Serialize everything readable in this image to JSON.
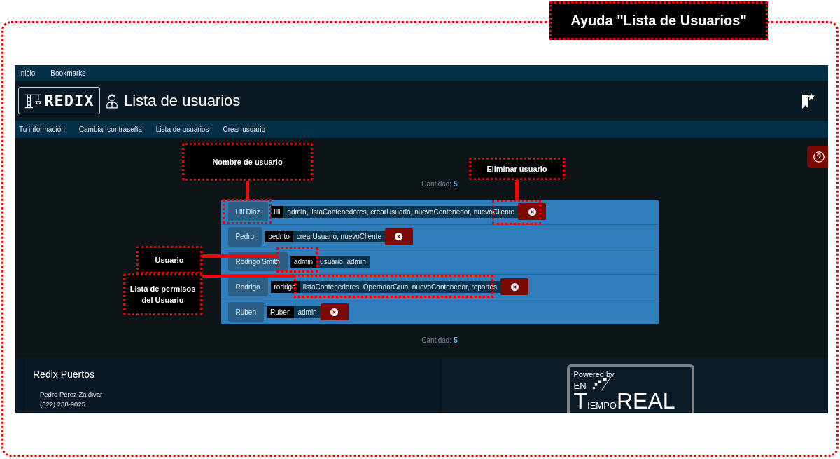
{
  "help_title": "Ayuda \"Lista de Usuarios\"",
  "top_menu": [
    "Inicio",
    "Bookmarks"
  ],
  "header": {
    "logo_text": "REDIX",
    "title": "Lista de usuarios"
  },
  "nav": [
    "Tu información",
    "Cambiar contraseña",
    "Lista de usuarios",
    "Crear usuario"
  ],
  "count_top": {
    "label": "Cantidad:",
    "value": "5"
  },
  "users": [
    {
      "name": "Lili Diaz",
      "username": "lili",
      "permissions": "admin, listaContenedores, crearUsuario, nuevoContenedor, nuevoCliente",
      "deletable": true
    },
    {
      "name": "Pedro",
      "username": "pedrito",
      "permissions": "crearUsuario, nuevoCliente",
      "deletable": true
    },
    {
      "name": "Rodrigo Smith",
      "username": "admin",
      "permissions": "usuario, admin",
      "deletable": false
    },
    {
      "name": "Rodrigo",
      "username": "rodrigo",
      "permissions": "listaContenedores, OperadorGrua, nuevoContenedor, reportes",
      "deletable": true
    },
    {
      "name": "Ruben",
      "username": "Ruben",
      "permissions": "admin",
      "deletable": true
    }
  ],
  "count_bottom": {
    "label": "Cantidad:",
    "value": "5"
  },
  "footer": {
    "company": "Redix Puertos",
    "contact_name": "Pedro Perez Zaldivar",
    "phone": "(322) 238-9025"
  },
  "powered_by": {
    "caption": "Powered by",
    "en": "EN",
    "initial": "T",
    "rest": "IEMPO",
    "real": "REAL"
  },
  "callouts": [
    {
      "label": "Nombre de usuario"
    },
    {
      "label": "Eliminar usuario"
    },
    {
      "label": "Usuario"
    },
    {
      "label": "Lista de permisos del Usuario"
    }
  ]
}
